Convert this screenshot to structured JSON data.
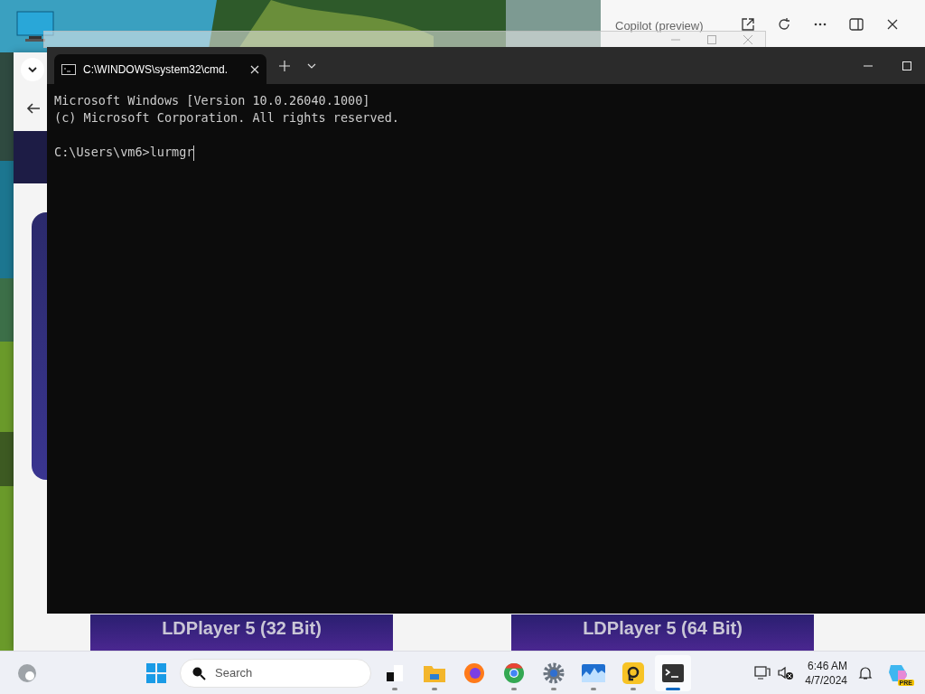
{
  "copilot": {
    "title": "Copilot (preview)"
  },
  "terminal": {
    "tabs": [
      {
        "title": "C:\\WINDOWS\\system32\\cmd.",
        "selected": true
      }
    ],
    "output": [
      "Microsoft Windows [Version 10.0.26040.1000]",
      "(c) Microsoft Corporation. All rights reserved."
    ],
    "prompt": "C:\\Users\\vm6>",
    "input": "lurmgr"
  },
  "banners": [
    {
      "title": "LDPlayer 5 (32 Bit)"
    },
    {
      "title": "LDPlayer 5 (64 Bit)"
    }
  ],
  "taskbar": {
    "search": {
      "placeholder": "Search"
    },
    "apps": [
      {
        "kind": "files",
        "running": true,
        "selected": false
      },
      {
        "kind": "folder",
        "running": true,
        "selected": false
      },
      {
        "kind": "firefox",
        "running": false,
        "selected": false
      },
      {
        "kind": "chrome",
        "running": true,
        "selected": false
      },
      {
        "kind": "settings",
        "running": true,
        "selected": false
      },
      {
        "kind": "monitor",
        "running": true,
        "selected": false
      },
      {
        "kind": "player",
        "running": true,
        "selected": false
      },
      {
        "kind": "terminal",
        "running": true,
        "selected": true
      }
    ],
    "time": "6:46 AM",
    "date": "4/7/2024",
    "badge": "PRE"
  }
}
